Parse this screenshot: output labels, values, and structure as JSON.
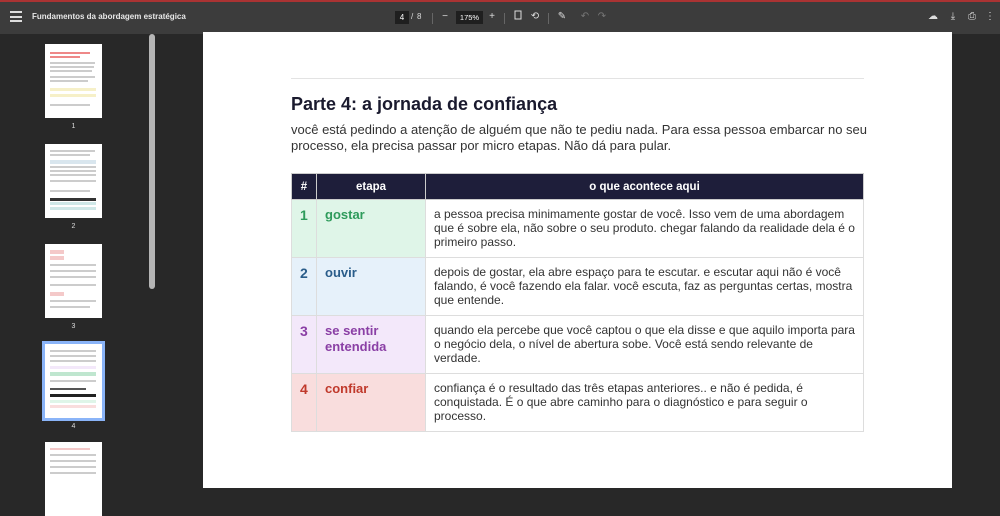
{
  "toolbar": {
    "title": "Fundamentos da abordagem estratégica",
    "current_page": "4",
    "page_separator": "/",
    "total_pages": "8",
    "zoom": "175%"
  },
  "thumbnails": [
    {
      "label": "1"
    },
    {
      "label": "2"
    },
    {
      "label": "3"
    },
    {
      "label": "4"
    }
  ],
  "document": {
    "heading": "Parte 4: a jornada de confiança",
    "intro": "você está pedindo a atenção de alguém que não te pediu nada. Para essa pessoa embarcar no seu processo, ela precisa passar por micro etapas. Não dá para pular.",
    "table": {
      "headers": [
        "#",
        "etapa",
        "o que acontece aqui"
      ],
      "rows": [
        {
          "num": "1",
          "etapa": "gostar",
          "desc": "a pessoa precisa minimamente gostar de você. Isso vem de uma abordagem que é sobre ela, não sobre o seu produto. chegar falando da realidade dela é o primeiro passo.",
          "color": "#2e9b5b",
          "bg": "#dff5e8"
        },
        {
          "num": "2",
          "etapa": "ouvir",
          "desc": "depois de gostar, ela abre espaço para te escutar. e escutar aqui não é você falando, é você fazendo ela falar. você escuta, faz as perguntas certas, mostra que entende.",
          "color": "#2a5d8a",
          "bg": "#e6f1fa"
        },
        {
          "num": "3",
          "etapa": "se sentir entendida",
          "desc": "quando ela percebe que você captou o que ela disse e que aquilo importa para o negócio dela, o nível de abertura sobe. Você está sendo relevante de verdade.",
          "color": "#8a3fa5",
          "bg": "#f3e8fa"
        },
        {
          "num": "4",
          "etapa": "confiar",
          "desc": "confiança é o resultado das três etapas anteriores.. e não é pedida, é conquistada. É o que abre caminho para o diagnóstico e para seguir o processo.",
          "color": "#c0392b",
          "bg": "#f9dddd"
        }
      ]
    }
  }
}
